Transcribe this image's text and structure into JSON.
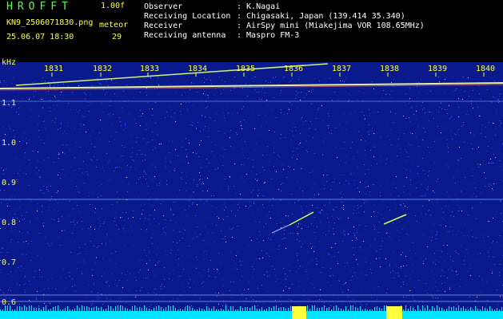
{
  "header": {
    "app_title": "HROFFT",
    "version": "1.00f",
    "file_name": "KN9_2506071830.png",
    "meteor_label": "meteor",
    "datetime": "25.06.07 18:30",
    "meteor_count": "29"
  },
  "info": [
    {
      "label": "Observer",
      "value": ": K.Nagai"
    },
    {
      "label": "Receiving Location",
      "value": ": Chigasaki, Japan (139.414 35.340)"
    },
    {
      "label": "Receiver",
      "value": ": AirSpy mini (Miakejima VOR 108.65MHz)"
    },
    {
      "label": "Receiving antenna",
      "value": ": Maspro FM-3"
    }
  ],
  "spectrogram": {
    "unit": "kHz",
    "y_ticks": [
      "1.1",
      "1.0",
      "0.9",
      "0.8",
      "0.7",
      "0.6"
    ],
    "x_ticks": [
      "1831",
      "1832",
      "1833",
      "1834",
      "1835",
      "1836",
      "1837",
      "1838",
      "1839",
      "1840"
    ],
    "colors": {
      "background": "#0a1a8c",
      "noise": "#3c6cff",
      "signal": "#ffff3c",
      "band": "#00e5ff"
    }
  }
}
